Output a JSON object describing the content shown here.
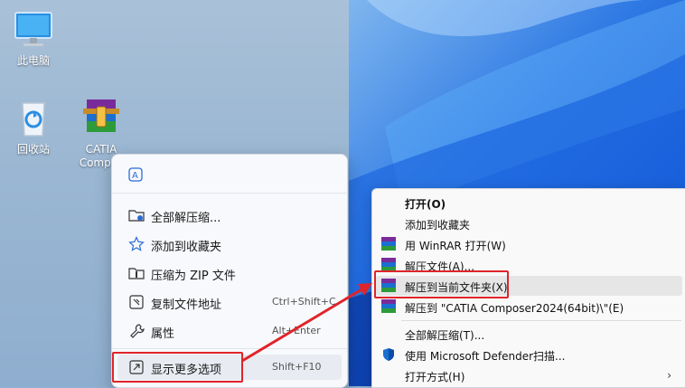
{
  "desktop": {
    "icons": [
      {
        "label": "此电脑"
      },
      {
        "label": "回收站"
      },
      {
        "label": "CATIA",
        "label2": "Compos"
      }
    ]
  },
  "menu_compact": {
    "items": [
      {
        "label": "全部解压缩...",
        "icon": "extract-folder-icon",
        "shortcut": ""
      },
      {
        "label": "添加到收藏夹",
        "icon": "star-icon",
        "shortcut": ""
      },
      {
        "label": "压缩为 ZIP 文件",
        "icon": "zip-icon",
        "shortcut": ""
      },
      {
        "label": "复制文件地址",
        "icon": "copy-path-icon",
        "shortcut": "Ctrl+Shift+C"
      },
      {
        "label": "属性",
        "icon": "wrench-icon",
        "shortcut": "Alt+Enter"
      },
      {
        "label": "显示更多选项",
        "icon": "more-options-icon",
        "shortcut": "Shift+F10"
      }
    ]
  },
  "menu_classic": {
    "items": [
      {
        "label": "打开(O)"
      },
      {
        "label": "添加到收藏夹"
      },
      {
        "label": "用 WinRAR 打开(W)"
      },
      {
        "label": "解压文件(A)..."
      },
      {
        "label": "解压到当前文件夹(X)"
      },
      {
        "label": "解压到 \"CATIA Composer2024(64bit)\\\"(E)"
      },
      {
        "label": "全部解压缩(T)..."
      },
      {
        "label": "使用 Microsoft Defender扫描..."
      },
      {
        "label": "打开方式(H)"
      }
    ],
    "submenu_chevron": "›"
  },
  "colors": {
    "annotation_red": "#e0242a",
    "wallpaper_blue": "#0c4fd0"
  }
}
